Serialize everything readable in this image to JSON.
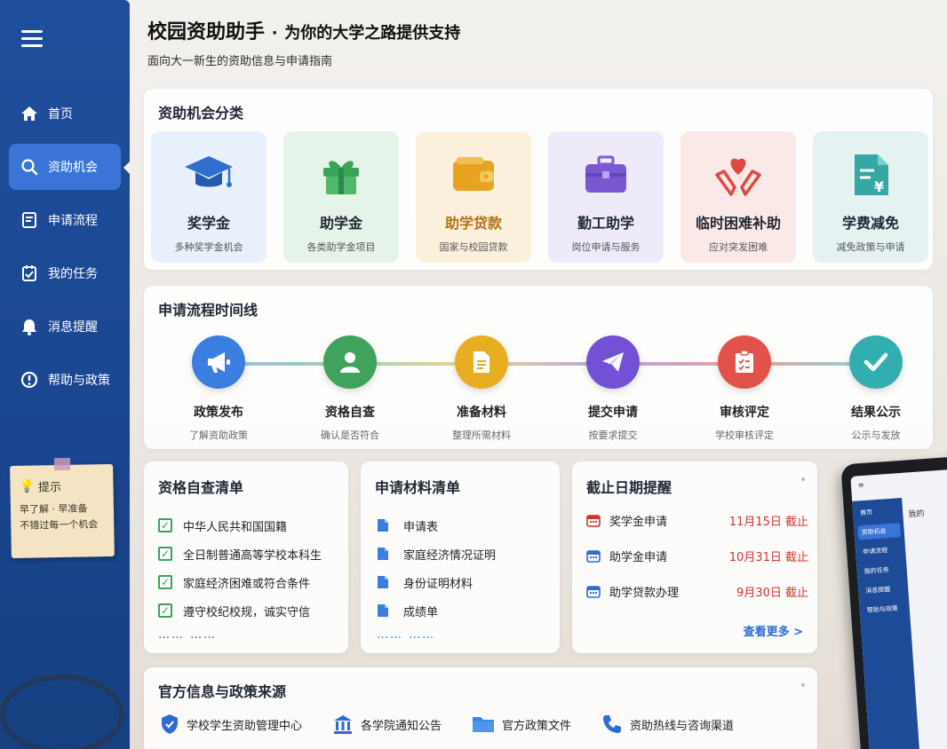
{
  "header": {
    "title_main": "校园资助助手",
    "title_dot": "·",
    "title_tail": "为你的大学之路提供支持",
    "subtitle": "面向大一新生的资助信息与申请指南"
  },
  "sidebar": {
    "items": [
      {
        "label": "首页",
        "icon": "home-icon"
      },
      {
        "label": "资助机会",
        "icon": "search-icon",
        "active": true
      },
      {
        "label": "申请流程",
        "icon": "form-icon"
      },
      {
        "label": "我的任务",
        "icon": "task-icon"
      },
      {
        "label": "消息提醒",
        "icon": "bell-icon"
      },
      {
        "label": "帮助与政策",
        "icon": "info-icon"
      }
    ],
    "note": {
      "title": "提示",
      "line1": "早了解 · 早准备",
      "line2": "不错过每一个机会"
    }
  },
  "categories": {
    "title": "资助机会分类",
    "items": [
      {
        "name": "奖学金",
        "desc": "多种奖学金机会",
        "bg": "#e8f0fb",
        "icon": "graduation-cap-icon",
        "color": "#2f6fd0"
      },
      {
        "name": "助学金",
        "desc": "各类助学金项目",
        "bg": "#e6f3e8",
        "icon": "gift-icon",
        "color": "#3aa35a"
      },
      {
        "name": "助学贷款",
        "desc": "国家与校园贷款",
        "bg": "#fbf0dc",
        "icon": "wallet-icon",
        "color": "#e8a322"
      },
      {
        "name": "勤工助学",
        "desc": "岗位申请与服务",
        "bg": "#eeeafa",
        "icon": "briefcase-icon",
        "color": "#7a58cf"
      },
      {
        "name": "临时困难补助",
        "desc": "应对突发困难",
        "bg": "#fbe9e8",
        "icon": "heart-hands-icon",
        "color": "#dc4b42"
      },
      {
        "name": "学费减免",
        "desc": "减免政策与申请",
        "bg": "#e4f3f2",
        "icon": "fee-document-icon",
        "color": "#35a7a4"
      }
    ]
  },
  "timeline": {
    "title": "申请流程时间线",
    "steps": [
      {
        "label": "政策发布",
        "desc": "了解资助政策",
        "color": "#3a7fe0",
        "icon": "megaphone-icon"
      },
      {
        "label": "资格自查",
        "desc": "确认是否符合",
        "color": "#3fa35d",
        "icon": "user-icon"
      },
      {
        "label": "准备材料",
        "desc": "整理所需材料",
        "color": "#e8ae22",
        "icon": "document-icon"
      },
      {
        "label": "提交申请",
        "desc": "按要求提交",
        "color": "#7351d5",
        "icon": "paper-plane-icon"
      },
      {
        "label": "审核评定",
        "desc": "学校审核评定",
        "color": "#e2524a",
        "icon": "checklist-icon"
      },
      {
        "label": "结果公示",
        "desc": "公示与发放",
        "color": "#33aeb0",
        "icon": "check-icon"
      }
    ]
  },
  "eligibility": {
    "title": "资格自查清单",
    "items": [
      "中华人民共和国国籍",
      "全日制普通高等学校本科生",
      "家庭经济困难或符合条件",
      "遵守校纪校规，诚实守信"
    ],
    "ellipsis": "…… ……"
  },
  "materials": {
    "title": "申请材料清单",
    "items": [
      "申请表",
      "家庭经济情况证明",
      "身份证明材料",
      "成绩单"
    ],
    "ellipsis": "…… ……"
  },
  "deadlines": {
    "title": "截止日期提醒",
    "items": [
      {
        "name": "奖学金申请",
        "date": "11月15日 截止",
        "icon_color": "#d0342c"
      },
      {
        "name": "助学金申请",
        "date": "10月31日 截止",
        "icon_color": "#2e6bd3"
      },
      {
        "name": "助学贷款办理",
        "date": "9月30日 截止",
        "icon_color": "#2e6bd3"
      }
    ],
    "view_more": "查看更多 >"
  },
  "sources": {
    "title": "官方信息与政策来源",
    "items": [
      {
        "label": "学校学生资助管理中心",
        "icon": "shield-icon"
      },
      {
        "label": "各学院通知公告",
        "icon": "building-icon"
      },
      {
        "label": "官方政策文件",
        "icon": "folder-icon"
      },
      {
        "label": "资助热线与咨询渠道",
        "icon": "phone-icon"
      }
    ]
  },
  "tablet": {
    "top": "≡",
    "items": [
      "首页",
      "资助机会",
      "申请流程",
      "我的任务",
      "消息提醒",
      "帮助与政策"
    ],
    "content": "我的"
  }
}
